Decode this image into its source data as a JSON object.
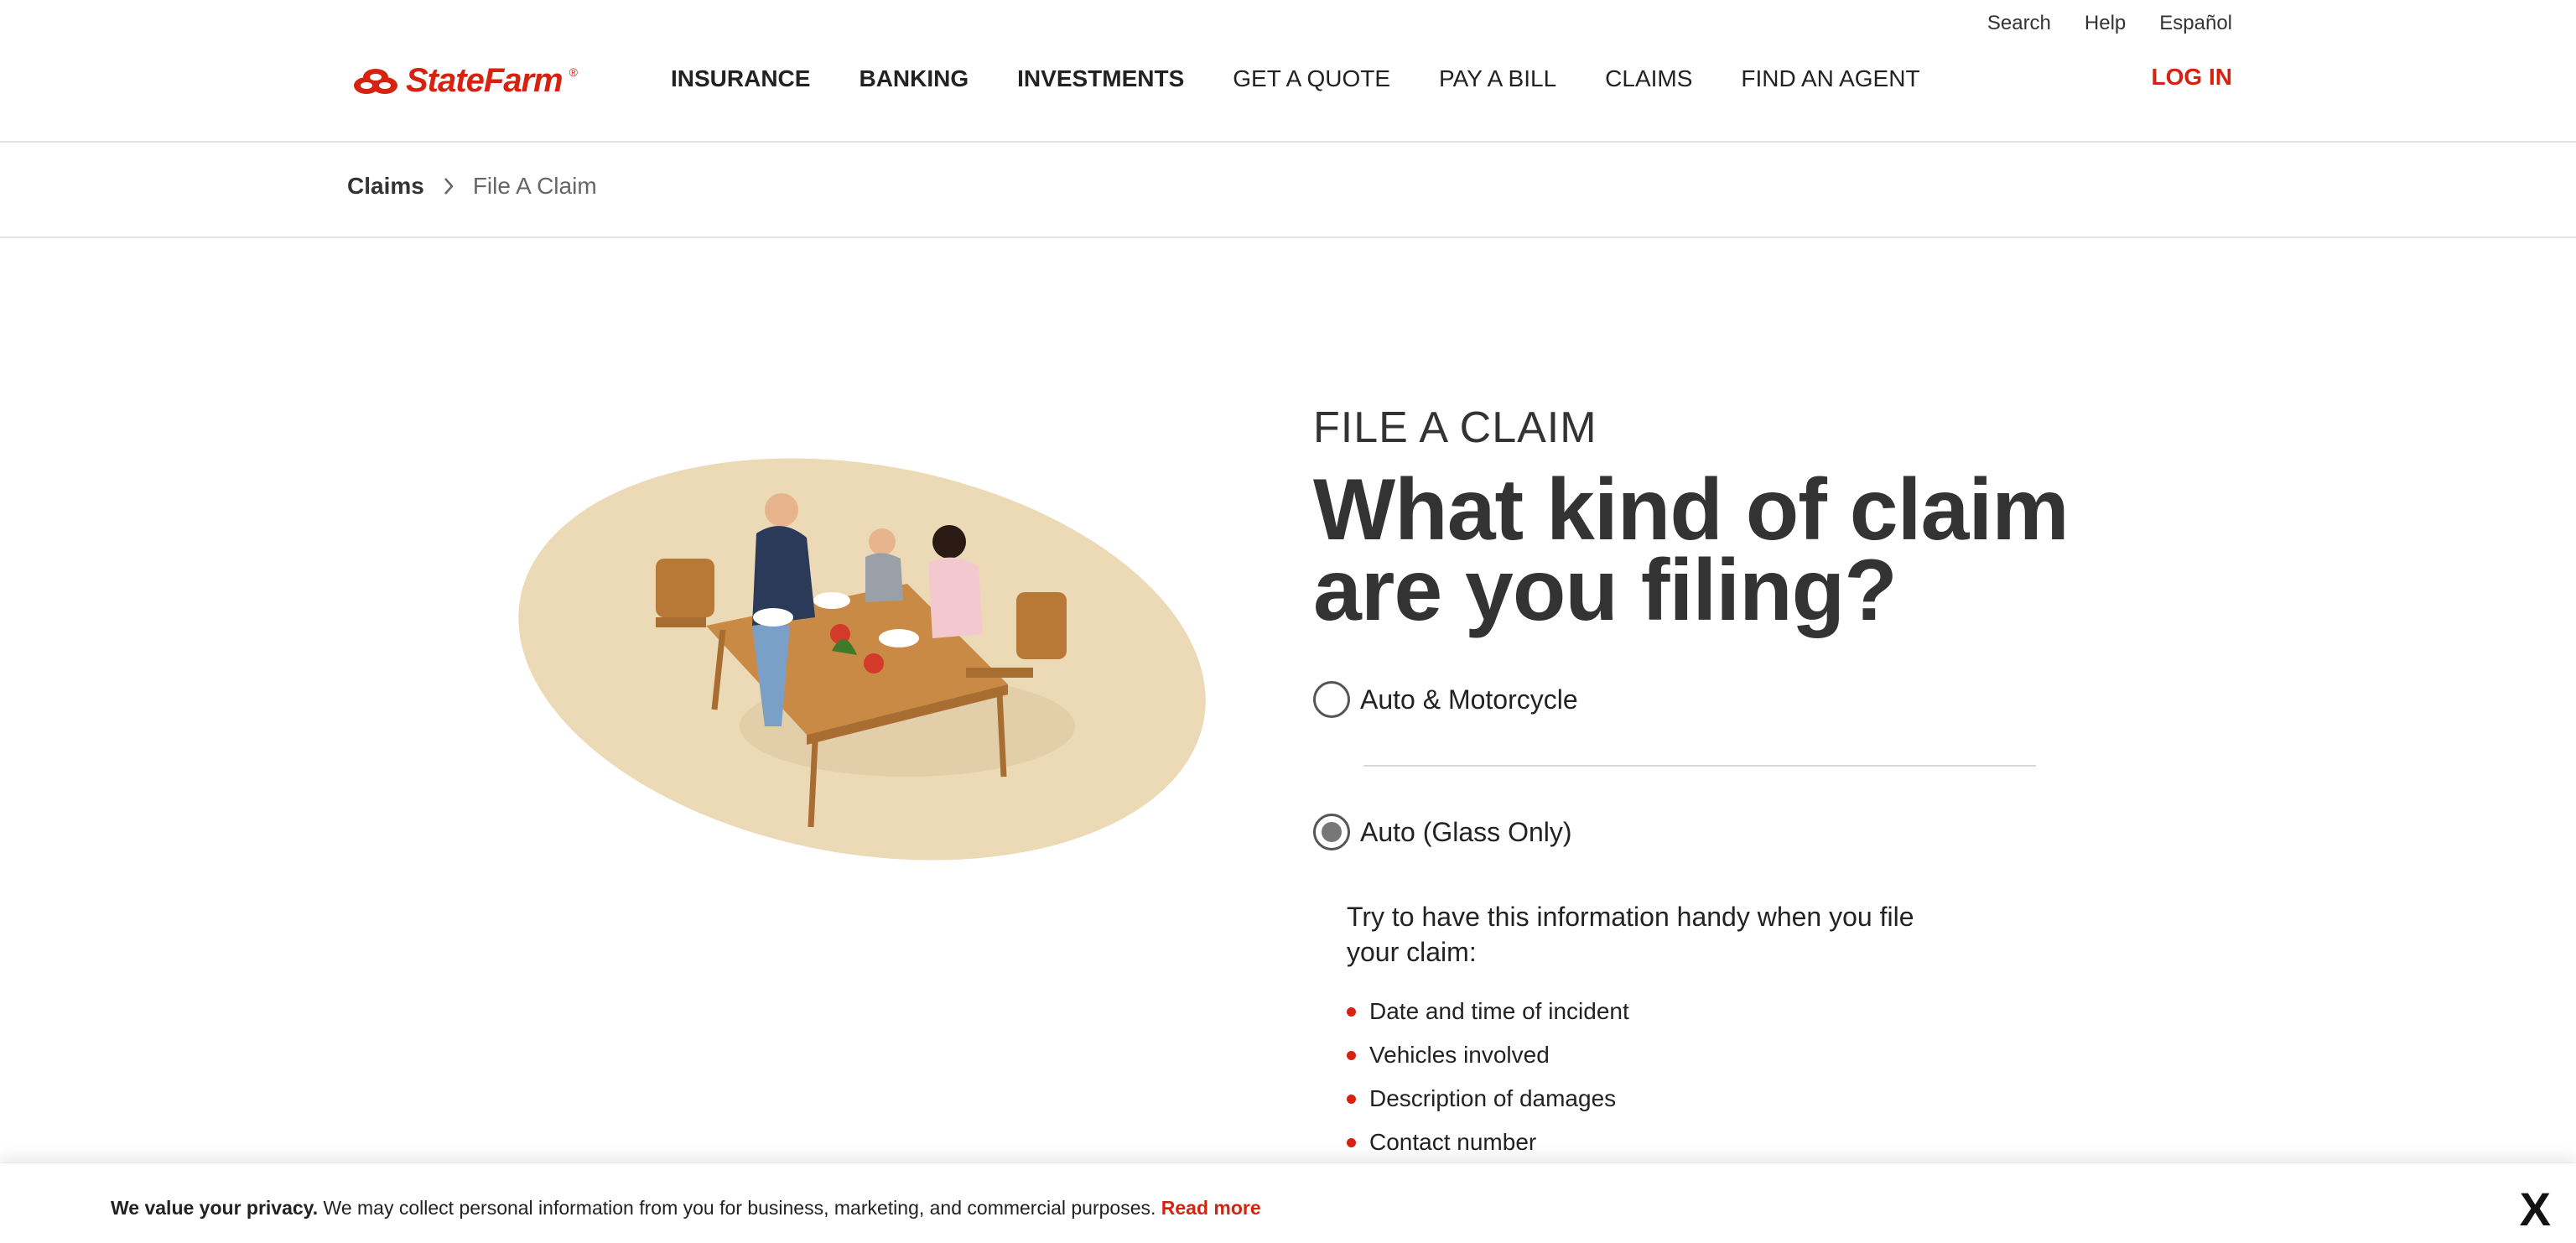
{
  "brand": {
    "name": "StateFarm",
    "accent": "#d62311"
  },
  "utility_links": [
    "Search",
    "Help",
    "Español"
  ],
  "nav": [
    {
      "label": "INSURANCE"
    },
    {
      "label": "BANKING"
    },
    {
      "label": "INVESTMENTS"
    },
    {
      "label": "GET A QUOTE"
    },
    {
      "label": "PAY A BILL"
    },
    {
      "label": "CLAIMS"
    },
    {
      "label": "FIND AN AGENT"
    }
  ],
  "login_label": "LOG IN",
  "breadcrumb": {
    "root": "Claims",
    "current": "File A Claim"
  },
  "form": {
    "eyebrow": "FILE A CLAIM",
    "headline": "What kind of claim are you filing?",
    "options": [
      {
        "label": "Auto & Motorcycle",
        "selected": false
      },
      {
        "label": "Auto (Glass Only)",
        "selected": true
      }
    ]
  },
  "info": {
    "lead": "Try to have this information handy when you file your claim:",
    "items": [
      "Date and time of incident",
      "Vehicles involved",
      "Description of damages",
      "Contact number"
    ]
  },
  "privacy": {
    "bold": "We value your privacy.",
    "text": "We may collect personal information from you for business, marketing, and commercial purposes.",
    "link": "Read more",
    "close": "X"
  }
}
